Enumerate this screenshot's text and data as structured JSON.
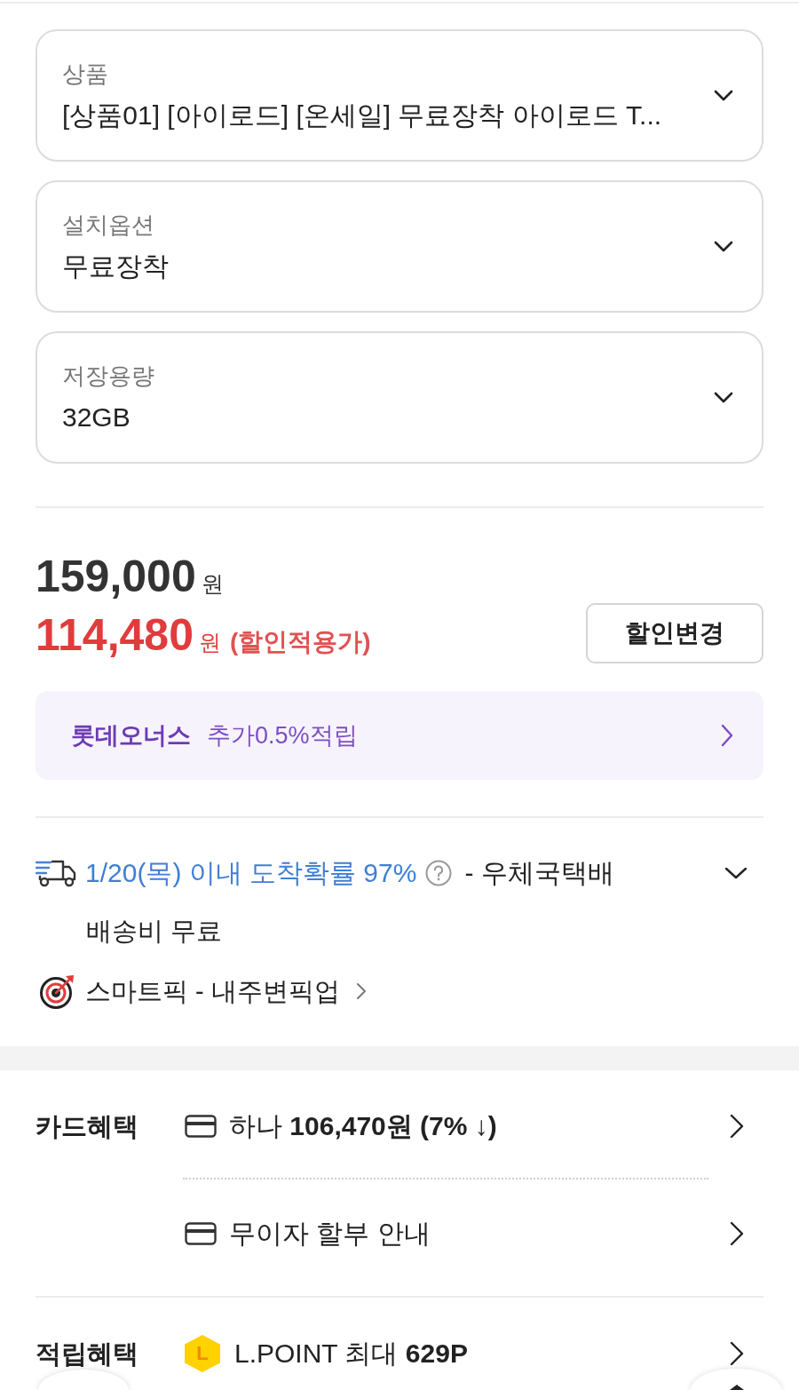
{
  "selects": [
    {
      "label": "상품",
      "value": "[상품01] [아이로드] [온세일] 무료장착 아이로드 T..."
    },
    {
      "label": "설치옵션",
      "value": "무료장착"
    },
    {
      "label": "저장용량",
      "value": "32GB"
    }
  ],
  "price": {
    "original": "159,000",
    "original_unit": "원",
    "sale": "114,480",
    "sale_unit": "원",
    "sale_note": "(할인적용가)",
    "discount_button": "할인변경"
  },
  "membership_banner": {
    "brand": "롯데오너스",
    "text": "추가0.5%적립"
  },
  "delivery": {
    "eta": "1/20(목) 이내 도착확률 97%",
    "carrier": "- 우체국택배",
    "expanded": false,
    "fee": "배송비 무료",
    "pickup": "스마트픽 - 내주변픽업"
  },
  "benefits": [
    {
      "title": "카드혜택",
      "items": [
        {
          "kind": "card",
          "text": "하나 **106,470원 (7% ↓)**"
        },
        {
          "kind": "card",
          "text": "무이자 할부 안내"
        }
      ]
    },
    {
      "title": "적립혜택",
      "items": [
        {
          "kind": "lpoint",
          "badge": "L",
          "text": "L.POINT 최대 **629P**"
        }
      ]
    }
  ]
}
